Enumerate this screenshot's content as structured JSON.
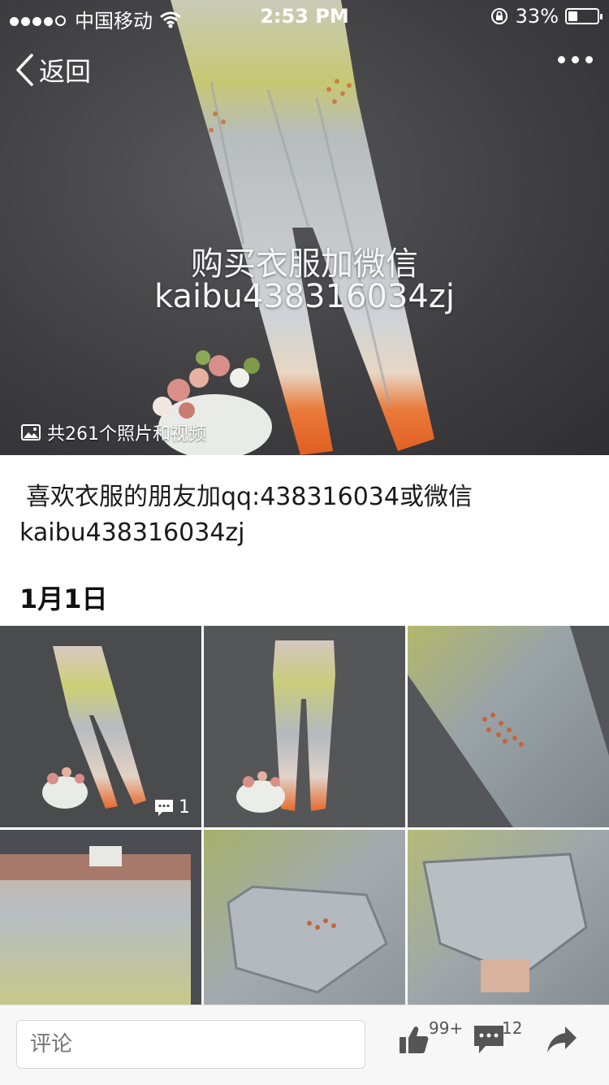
{
  "status_bar": {
    "carrier": "中国移动",
    "time": "2:53 PM",
    "battery": "33%",
    "battery_level": 0.33
  },
  "nav": {
    "back_label": "返回"
  },
  "hero": {
    "overlay_line1": "购买衣服加微信",
    "overlay_line2": "kaibu438316034zj",
    "photo_count": "共261个照片和视频"
  },
  "post": {
    "description_line1": "喜欢衣服的朋友加qq:438316034或微信",
    "description_line2": "kaibu438316034zj",
    "date": "1月1日"
  },
  "grid": {
    "first_item_comment_count": "1"
  },
  "bottom_bar": {
    "comment_placeholder": "评论",
    "like_count": "99+",
    "comment_count": "12"
  },
  "icons": {
    "back": "chevron-left-icon",
    "more": "more-dots-icon",
    "photo": "image-icon",
    "like": "thumbs-up-icon",
    "comment": "comment-bubble-icon",
    "share": "share-arrow-icon",
    "wifi": "wifi-icon",
    "lock": "rotation-lock-icon"
  },
  "colors": {
    "accent_text": "#1a1a1a",
    "hint_text": "#9a9a9a",
    "icon_gray": "#555555"
  }
}
